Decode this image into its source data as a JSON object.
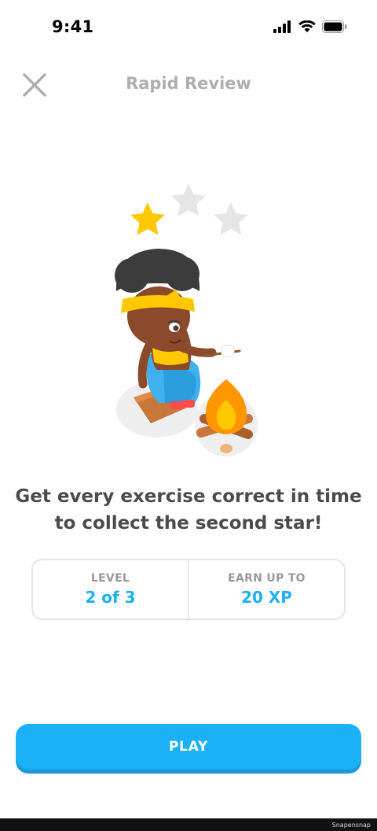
{
  "status_bar": {
    "time": "9:41",
    "icons": [
      "signal-icon",
      "wifi-icon",
      "battery-icon"
    ]
  },
  "header": {
    "close_icon": "close-icon",
    "title": "Rapid Review"
  },
  "illustration": {
    "stars_earned": 1,
    "stars_total": 3,
    "colors": {
      "star_filled": "#ffc800",
      "star_empty": "#e5e5e5",
      "hair": "#3c3c3c",
      "headband": "#ffc800",
      "skin": "#8b4a2b",
      "dress": "#40b0f0",
      "fire": "#ff9600",
      "log": "#c9763b"
    }
  },
  "headline": {
    "line1": "Get every exercise correct in time",
    "line2": "to collect the second star!"
  },
  "stats": {
    "level_label": "LEVEL",
    "level_value": "2 of 3",
    "xp_label": "EARN UP TO",
    "xp_value": "20 XP"
  },
  "play_button": {
    "label": "PLAY",
    "color": "#1cb0f6"
  },
  "watermark": "Snapensnap"
}
